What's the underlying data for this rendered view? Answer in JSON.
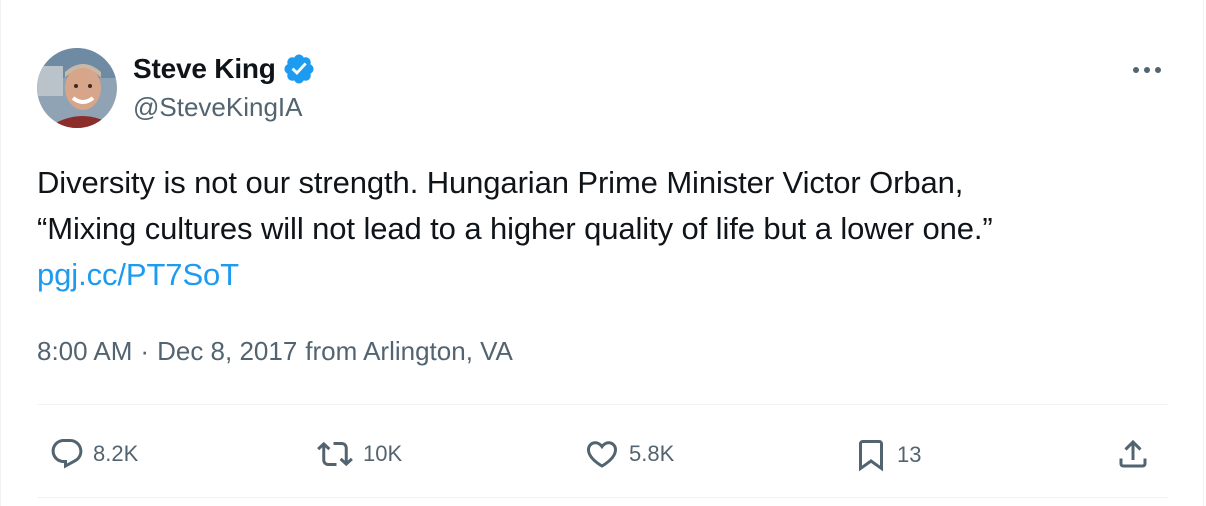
{
  "author": {
    "display_name": "Steve King",
    "handle": "@SteveKingIA",
    "verified": true,
    "avatar_icon": "profile-photo"
  },
  "tweet": {
    "line1": "Diversity is not our strength. Hungarian Prime Minister Victor Orban,",
    "line2": "“Mixing cultures will not lead to a higher quality of life but a lower one.”",
    "link": "pgj.cc/PT7SoT"
  },
  "meta": {
    "time": "8:00 AM",
    "separator": "·",
    "date": "Dec 8, 2017",
    "location": "from Arlington, VA"
  },
  "actions": {
    "replies": "8.2K",
    "retweets": "10K",
    "likes": "5.8K",
    "bookmarks": "13"
  },
  "colors": {
    "text": "#0f1419",
    "secondary": "#536471",
    "link": "#1d9bf0",
    "verified": "#1d9bf0",
    "divider": "#eff3f4"
  },
  "icons": [
    "verified-badge-icon",
    "more-options-icon",
    "reply-icon",
    "retweet-icon",
    "like-icon",
    "bookmark-icon",
    "share-icon"
  ]
}
